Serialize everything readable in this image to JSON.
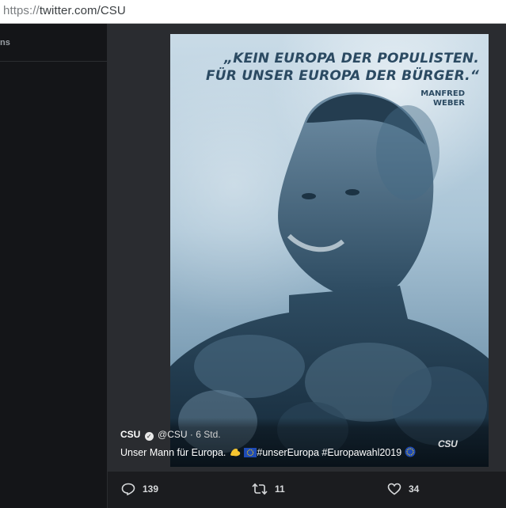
{
  "browser": {
    "url_protocol": "https://",
    "url_host_path": "twitter.com/CSU"
  },
  "left_panel": {
    "header_fragment": "ns"
  },
  "poster": {
    "quote_line1": "„KEIN EUROPA DER POPULISTEN.",
    "quote_line2": "FÜR UNSER EUROPA DER BÜRGER.“",
    "name_line1": "MANFRED",
    "name_line2": "WEBER",
    "logo": "CSU"
  },
  "tweet": {
    "display_name": "CSU",
    "handle": "@CSU",
    "separator": "·",
    "time": "6 Std.",
    "text_prefix": "Unser Mann für Europa.",
    "text_hashtags": "#unserEuropa #Europawahl2019"
  },
  "actions": {
    "replies": "139",
    "retweets": "11",
    "likes": "34"
  },
  "icons": {
    "reply": "reply-icon",
    "retweet": "retweet-icon",
    "like": "heart-icon",
    "verified": "verified-badge-icon"
  }
}
